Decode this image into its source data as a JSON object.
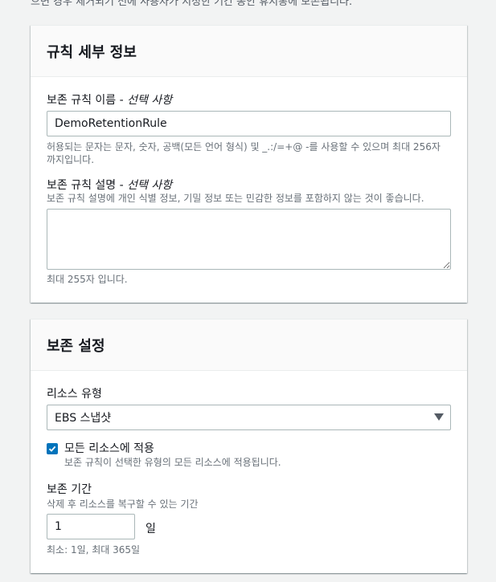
{
  "intro_text": "으면 경우 제거되기 전에 사용자가 지정한 기간 동안 휴지통에 보존됩니다.",
  "rule_details": {
    "title": "규칙 세부 정보",
    "name_label": "보존 규칙 이름 - ",
    "name_optional": "선택 사항",
    "name_value": "DemoRetentionRule",
    "name_hint_line1": "허용되는 문자는 문자, 숫자, 공백(모든 언어 형식) 및 _.:/=+@ -를 사용할 수 있으며 최대 256자",
    "name_hint_line2": "까지입니다.",
    "desc_label": "보존 규칙 설명 - ",
    "desc_optional": "선택 사항",
    "desc_help": "보존 규칙 설명에 개인 식별 정보, 기밀 정보 또는 민감한 정보를 포함하지 않는 것이 좋습니다.",
    "desc_value": "",
    "desc_limit": "최대 255자 입니다."
  },
  "retention_settings": {
    "title": "보존 설정",
    "resource_type_label": "리소스 유형",
    "resource_type_value": "EBS 스냅샷",
    "apply_all_label": "모든 리소스에 적용",
    "apply_all_checked": true,
    "apply_all_desc": "보존 규칙이 선택한 유형의 모든 리소스에 적용됩니다.",
    "period_label": "보존 기간",
    "period_help": "삭제 후 리소스를 복구할 수 있는 기간",
    "period_value": "1",
    "period_unit": "일",
    "period_constraint": "최소: 1일, 최대 365일"
  },
  "colors": {
    "accent": "#0073bb",
    "border": "#aab7b8",
    "muted_text": "#687078"
  }
}
